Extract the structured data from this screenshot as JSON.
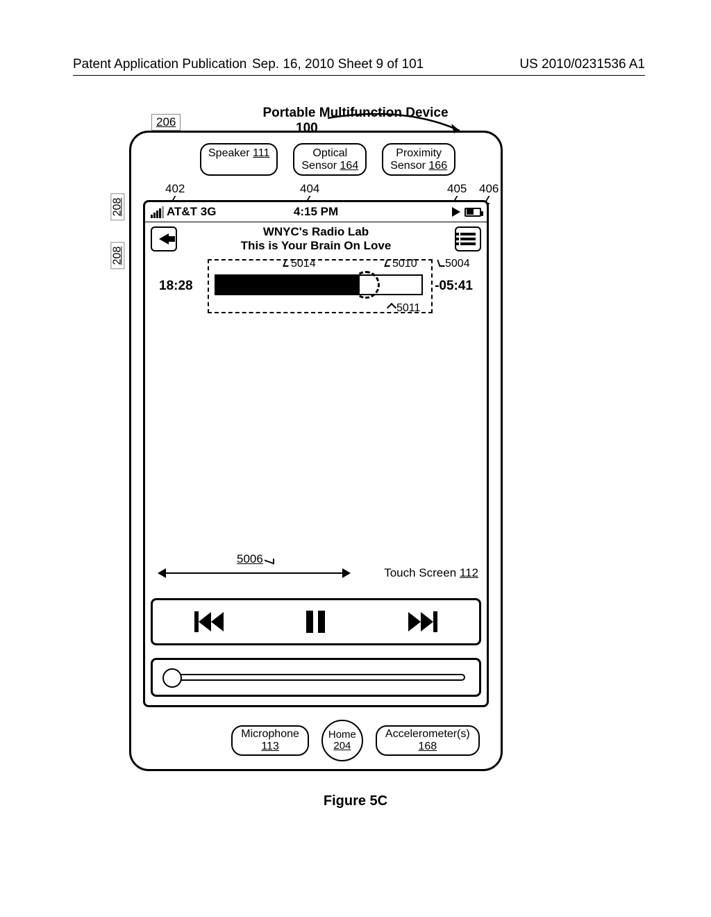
{
  "header": {
    "left": "Patent Application Publication",
    "mid": "Sep. 16, 2010  Sheet 9 of 101",
    "right": "US 2010/0231536 A1"
  },
  "device_title": "Portable Multifunction Device",
  "ref_100": "100",
  "ref_206": "206",
  "ref_208": "208",
  "sensors": {
    "speaker": {
      "label": "Speaker",
      "num": "111"
    },
    "optical": {
      "label1": "Optical",
      "label2": "Sensor",
      "num": "164"
    },
    "proximity": {
      "label1": "Proximity",
      "label2": "Sensor",
      "num": "166"
    }
  },
  "top_refs": {
    "r402": "402",
    "r404": "404",
    "r405": "405",
    "r406": "406"
  },
  "status": {
    "carrier": "AT&T 3G",
    "time": "4:15 PM"
  },
  "nav": {
    "title1": "WNYC's Radio Lab",
    "title2": "This is Your Brain On Love"
  },
  "scrubber": {
    "elapsed": "18:28",
    "remaining": "-05:41",
    "r5014": "5014",
    "r5010": "5010",
    "r5004": "5004",
    "r5011": "5011"
  },
  "r5006": "5006",
  "touch_screen": {
    "label": "Touch Screen",
    "num": "112"
  },
  "bottom": {
    "mic": {
      "label": "Microphone",
      "num": "113"
    },
    "home": {
      "label": "Home",
      "num": "204"
    },
    "acc": {
      "label": "Accelerometer(s)",
      "num": "168"
    }
  },
  "figure": "Figure 5C"
}
